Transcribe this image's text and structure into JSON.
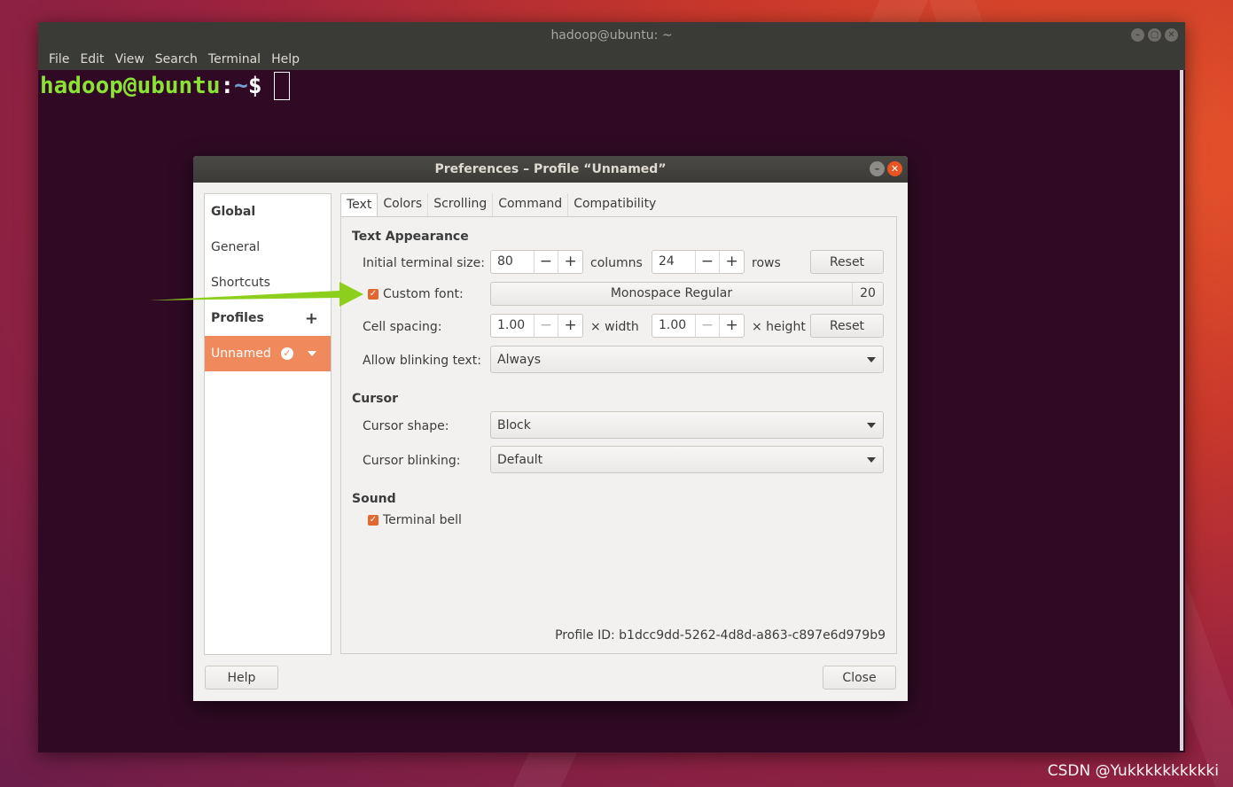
{
  "terminal": {
    "title": "hadoop@ubuntu: ~",
    "menu": [
      "File",
      "Edit",
      "View",
      "Search",
      "Terminal",
      "Help"
    ],
    "prompt_user": "hadoop@ubuntu",
    "prompt_colon": ":",
    "prompt_path": "~",
    "prompt_symbol": "$"
  },
  "dialog": {
    "title": "Preferences – Profile “Unnamed”",
    "sidebar": {
      "global_header": "Global",
      "general": "General",
      "shortcuts": "Shortcuts",
      "profiles_header": "Profiles",
      "add": "+",
      "selected_profile": "Unnamed"
    },
    "tabs": [
      "Text",
      "Colors",
      "Scrolling",
      "Command",
      "Compatibility"
    ],
    "active_tab": "Text",
    "text_appearance": {
      "section": "Text Appearance",
      "initial_size_label": "Initial terminal size:",
      "columns_value": "80",
      "columns_unit": "columns",
      "rows_value": "24",
      "rows_unit": "rows",
      "reset_label": "Reset",
      "custom_font_label": "Custom font:",
      "custom_font_checked": true,
      "font_name": "Monospace Regular",
      "font_size": "20",
      "cell_spacing_label": "Cell spacing:",
      "width_value": "1.00",
      "width_unit": "× width",
      "height_value": "1.00",
      "height_unit": "× height",
      "reset2_label": "Reset",
      "blink_label": "Allow blinking text:",
      "blink_value": "Always"
    },
    "cursor": {
      "section": "Cursor",
      "shape_label": "Cursor shape:",
      "shape_value": "Block",
      "blinking_label": "Cursor blinking:",
      "blinking_value": "Default"
    },
    "sound": {
      "section": "Sound",
      "bell_label": "Terminal bell",
      "bell_checked": true
    },
    "profile_id_label": "Profile ID:",
    "profile_id": "b1dcc9dd-5262-4d8d-a863-c897e6d979b9",
    "help_label": "Help",
    "close_label": "Close"
  },
  "spin_minus": "−",
  "spin_plus": "+",
  "watermark": "CSDN @Yukkkkkkkkkki",
  "colors": {
    "accent": "#e95420",
    "selected": "#f08a5d",
    "arrow": "#8ccf1c",
    "terminal_bg": "#300a24"
  }
}
